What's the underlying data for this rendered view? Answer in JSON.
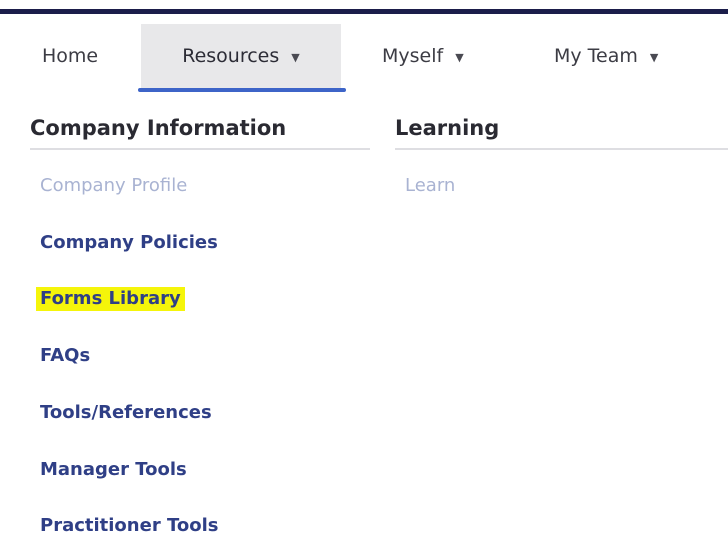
{
  "nav": {
    "home": "Home",
    "resources": "Resources",
    "myself": "Myself",
    "my_team": "My Team",
    "caret": "▼"
  },
  "columns": {
    "company_information": {
      "heading": "Company Information",
      "items": [
        "Company Profile",
        "Company Policies",
        "Forms Library",
        "FAQs",
        "Tools/References",
        "Manager Tools",
        "Practitioner Tools"
      ]
    },
    "learning": {
      "heading": "Learning",
      "items": [
        "Learn"
      ]
    }
  },
  "colors": {
    "accent": "#3d64c8",
    "link": "#2f3f86",
    "highlight": "#f5f50a"
  }
}
